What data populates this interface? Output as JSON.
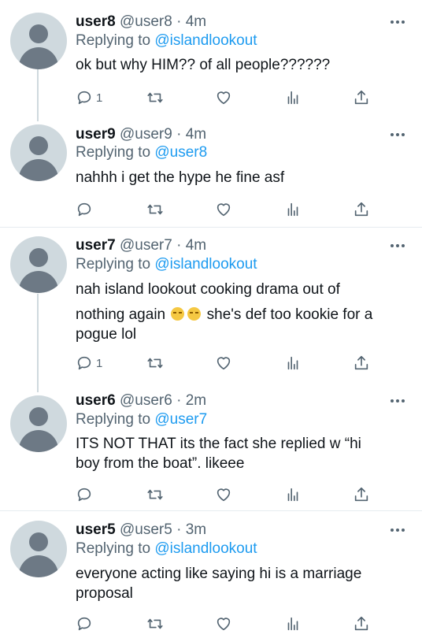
{
  "tweets": [
    {
      "name": "user8",
      "handle": "@user8",
      "dot": "·",
      "time": "4m",
      "reply_prefix": "Replying to",
      "reply_to": "@islandlookout",
      "lines": [
        "ok but why HIM??  of all people??????"
      ],
      "reply_count": "1"
    },
    {
      "name": "user9",
      "handle": "@user9",
      "dot": "·",
      "time": "4m",
      "reply_prefix": "Replying to",
      "reply_to": "@user8",
      "lines": [
        "nahhh i get the hype he fine asf"
      ],
      "reply_count": ""
    },
    {
      "name": "user7",
      "handle": "@user7",
      "dot": "·",
      "time": "4m",
      "reply_prefix": "Replying to",
      "reply_to": "@islandlookout",
      "lines": [
        "nah island lookout cooking drama out of",
        "nothing again",
        "she's def too kookie for a",
        "pogue lol"
      ],
      "reply_count": "1"
    },
    {
      "name": "user6",
      "handle": "@user6",
      "dot": "·",
      "time": "2m",
      "reply_prefix": "Replying to",
      "reply_to": "@user7",
      "lines": [
        "ITS NOT THAT its the fact she replied w “hi",
        "boy from the boat”. likeee"
      ],
      "reply_count": ""
    },
    {
      "name": "user5",
      "handle": "@user5",
      "dot": "·",
      "time": "3m",
      "reply_prefix": "Replying to",
      "reply_to": "@islandlookout",
      "lines": [
        "everyone acting like saying hi is a marriage",
        "proposal"
      ],
      "reply_count": ""
    }
  ],
  "icons": {
    "more": "more-icon",
    "reply": "reply-icon",
    "retweet": "retweet-icon",
    "like": "like-icon",
    "stats": "stats-icon",
    "share": "share-icon",
    "avatar": "default-avatar",
    "emoji": "unamused-face-emoji"
  },
  "colors": {
    "mention": "#1d9bf0",
    "muted": "#536471",
    "text": "#0f1419",
    "divider": "#e6ecf0",
    "thread": "#cfd9de"
  }
}
